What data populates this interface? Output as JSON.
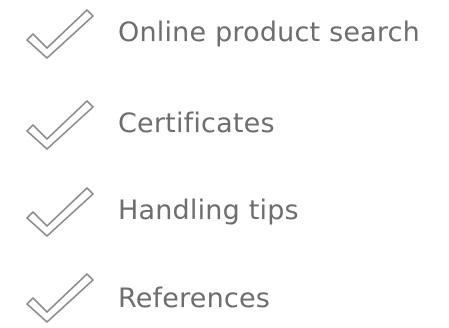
{
  "checklist": {
    "items": [
      {
        "label": "Online product search",
        "icon": "checkmark-outline-icon"
      },
      {
        "label": "Certificates",
        "icon": "checkmark-outline-icon"
      },
      {
        "label": "Handling tips",
        "icon": "checkmark-outline-icon"
      },
      {
        "label": "References",
        "icon": "checkmark-outline-icon"
      }
    ]
  },
  "colors": {
    "text": "#6e6e6e",
    "icon_stroke": "#8a8a8a",
    "background": "#ffffff"
  }
}
